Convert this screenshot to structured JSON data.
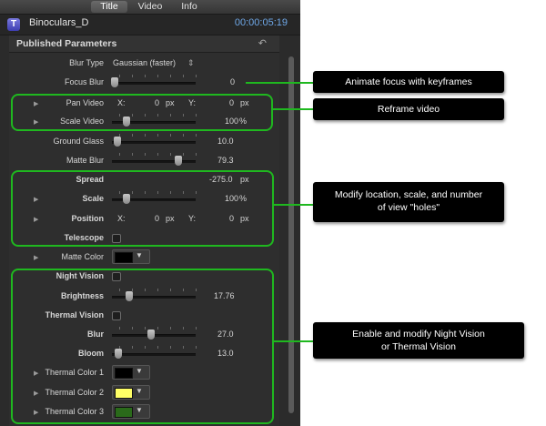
{
  "tabs": [
    {
      "label": "Title",
      "active": true
    },
    {
      "label": "Video",
      "active": false
    },
    {
      "label": "Info",
      "active": false
    }
  ],
  "clip": {
    "name": "Binoculars_D",
    "timecode": "00:00:05:19",
    "icon": "T"
  },
  "section": {
    "title": "Published Parameters",
    "reset_glyph": "↶"
  },
  "params": {
    "blur_type": {
      "label": "Blur Type",
      "value": "Gaussian (faster)",
      "stepper": "⇕"
    },
    "focus_blur": {
      "label": "Focus Blur",
      "value": "0",
      "slider_level": 0
    },
    "pan_video": {
      "label": "Pan Video",
      "x_label": "X:",
      "x_value": "0",
      "x_unit": "px",
      "y_label": "Y:",
      "y_value": "0",
      "y_unit": "px"
    },
    "scale_video": {
      "label": "Scale Video",
      "value": "100",
      "unit": "%",
      "slider_level": 0.15
    },
    "ground_glass": {
      "label": "Ground Glass",
      "value": "10.0",
      "slider_level": 0.03
    },
    "matte_blur": {
      "label": "Matte Blur",
      "value": "79.3",
      "slider_level": 0.79
    },
    "spread": {
      "label": "Spread",
      "value": "-275.0",
      "unit": "px"
    },
    "scale": {
      "label": "Scale",
      "value": "100",
      "unit": "%",
      "slider_level": 0.15
    },
    "position": {
      "label": "Position",
      "x_label": "X:",
      "x_value": "0",
      "x_unit": "px",
      "y_label": "Y:",
      "y_value": "0",
      "y_unit": "px"
    },
    "telescope": {
      "label": "Telescope",
      "checked": false
    },
    "matte_color": {
      "label": "Matte Color",
      "color": "#000000"
    },
    "night_vision": {
      "label": "Night Vision",
      "checked": false
    },
    "brightness": {
      "label": "Brightness",
      "value": "17.76",
      "slider_level": 0.18
    },
    "thermal_vision": {
      "label": "Thermal Vision",
      "checked": false
    },
    "blur": {
      "label": "Blur",
      "value": "27.0",
      "slider_level": 0.45
    },
    "bloom": {
      "label": "Bloom",
      "value": "13.0",
      "slider_level": 0.05
    },
    "thermal_color_1": {
      "label": "Thermal Color 1",
      "color": "#000000"
    },
    "thermal_color_2": {
      "label": "Thermal Color 2",
      "color": "#ffff66"
    },
    "thermal_color_3": {
      "label": "Thermal Color 3",
      "color": "#2a6a1a"
    }
  },
  "callouts": {
    "focus": "Animate focus with keyframes",
    "reframe": "Reframe video",
    "modify_line1": "Modify location, scale, and number",
    "modify_line2": "of view \"holes\"",
    "vision_line1": "Enable and modify Night Vision",
    "vision_line2": "or Thermal Vision"
  },
  "colors": {
    "highlight_green": "#1fb81f",
    "timecode_blue": "#6fa8e8",
    "callout_bg": "#000000"
  },
  "icons": {
    "disclosure": "▶",
    "popup_arrow": "▼"
  }
}
